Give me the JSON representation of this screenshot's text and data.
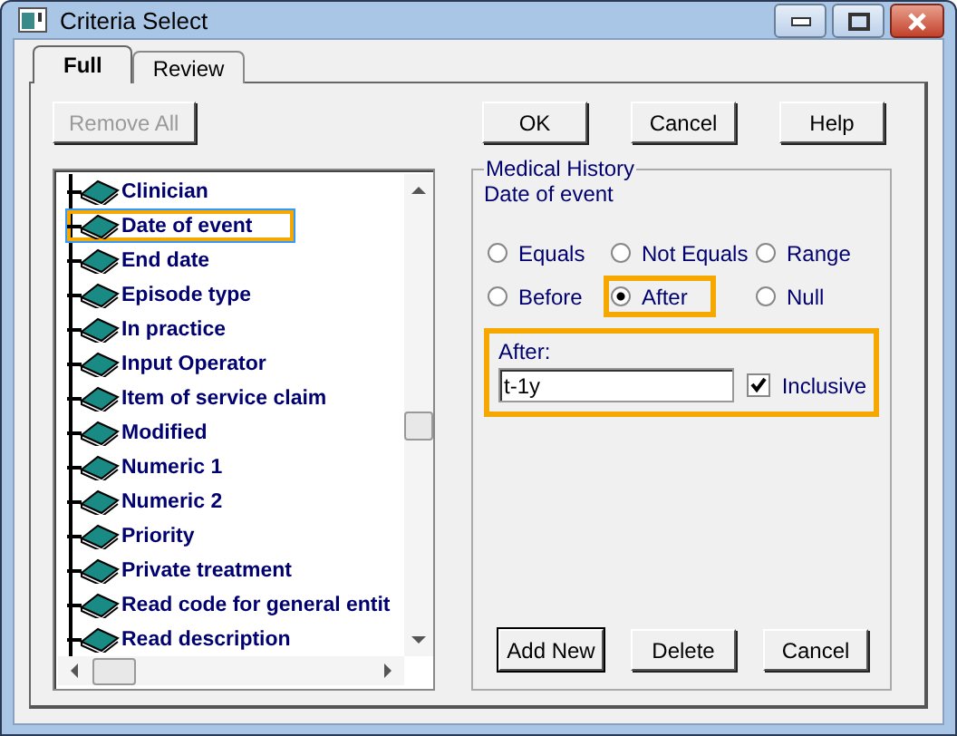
{
  "window": {
    "title": "Criteria Select"
  },
  "tabs": [
    {
      "label": "Full",
      "selected": true
    },
    {
      "label": "Review",
      "selected": false
    }
  ],
  "toolbar": {
    "remove_all": {
      "label": "Remove All",
      "disabled": true
    },
    "buttons": [
      "OK",
      "Cancel",
      "Help"
    ]
  },
  "tree": {
    "items": [
      {
        "label": "Clinician",
        "selected": false,
        "highlighted": false
      },
      {
        "label": "Date of event",
        "selected": true,
        "highlighted": true
      },
      {
        "label": "End date",
        "selected": false,
        "highlighted": false
      },
      {
        "label": "Episode type",
        "selected": false,
        "highlighted": false
      },
      {
        "label": "In practice",
        "selected": false,
        "highlighted": false
      },
      {
        "label": "Input Operator",
        "selected": false,
        "highlighted": false
      },
      {
        "label": "Item of service claim",
        "selected": false,
        "highlighted": false
      },
      {
        "label": "Modified",
        "selected": false,
        "highlighted": false
      },
      {
        "label": "Numeric 1",
        "selected": false,
        "highlighted": false
      },
      {
        "label": "Numeric 2",
        "selected": false,
        "highlighted": false
      },
      {
        "label": "Priority",
        "selected": false,
        "highlighted": false
      },
      {
        "label": "Private treatment",
        "selected": false,
        "highlighted": false
      },
      {
        "label": "Read code for general entit",
        "selected": false,
        "highlighted": false
      },
      {
        "label": "Read description",
        "selected": false,
        "highlighted": false
      }
    ]
  },
  "panel": {
    "group_title": "Medical History",
    "subtitle": "Date of event",
    "options": [
      {
        "label": "Equals",
        "selected": false,
        "highlighted": false
      },
      {
        "label": "Not Equals",
        "selected": false,
        "highlighted": false
      },
      {
        "label": "Range",
        "selected": false,
        "highlighted": false
      },
      {
        "label": "Before",
        "selected": false,
        "highlighted": false
      },
      {
        "label": "After",
        "selected": true,
        "highlighted": true
      },
      {
        "label": "Null",
        "selected": false,
        "highlighted": false
      }
    ],
    "value_group": {
      "label": "After:",
      "value": "t-1y",
      "inclusive": {
        "label": "Inclusive",
        "checked": true
      },
      "highlighted": true
    },
    "buttons": [
      "Add New",
      "Delete",
      "Cancel"
    ]
  }
}
